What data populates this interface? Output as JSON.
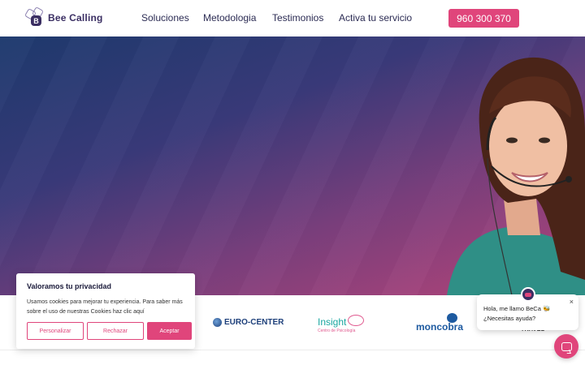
{
  "header": {
    "logo_text": "Bee Calling",
    "logo_letter": "B",
    "nav": [
      "Soluciones",
      "Metodologia",
      "Testimonios",
      "Activa tu servicio"
    ],
    "phone": "960 300 370"
  },
  "colors": {
    "brand_pink": "#e0457b",
    "brand_navy": "#3b2f63",
    "hero_gradient_start": "#1e3a6e",
    "hero_gradient_end": "#b8457a"
  },
  "client_logos": {
    "euro_center": "EURO-CENTER",
    "insight": "Insight",
    "insight_sub": "Centro de Psicología",
    "moncobra": "moncobra",
    "travel": "TRAVEL"
  },
  "cookie_banner": {
    "title": "Valoramos tu privacidad",
    "text": "Usamos cookies para mejorar tu experiencia. Para saber más sobre el uso de nuestras Cookies haz clic aquí",
    "customize": "Personalizar",
    "reject": "Rechazar",
    "accept": "Aceptar"
  },
  "chat": {
    "line1": "Hola, me llamo BeCa 🐝",
    "line2": "¿Necesitas ayuda?",
    "close": "×"
  }
}
